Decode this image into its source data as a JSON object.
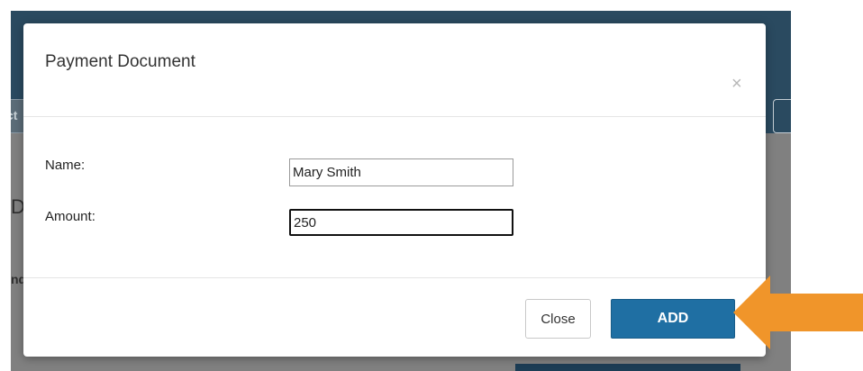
{
  "modal": {
    "title": "Payment Document",
    "close_glyph": "×",
    "fields": {
      "name": {
        "label": "Name:",
        "value": "Mary Smith"
      },
      "amount": {
        "label": "Amount:",
        "value": "250"
      }
    },
    "footer": {
      "close_label": "Close",
      "add_label": "ADD"
    }
  },
  "background": {
    "tab_fragment": "ct",
    "heading_fragment": "D",
    "text_fragment": "nd"
  },
  "annotation": {
    "arrow_color": "#f0952a",
    "arrow_icon": "arrow-left-icon"
  },
  "colors": {
    "header_bg": "#2a4a60",
    "primary": "#1f6fa3",
    "overlay": "#808080"
  }
}
